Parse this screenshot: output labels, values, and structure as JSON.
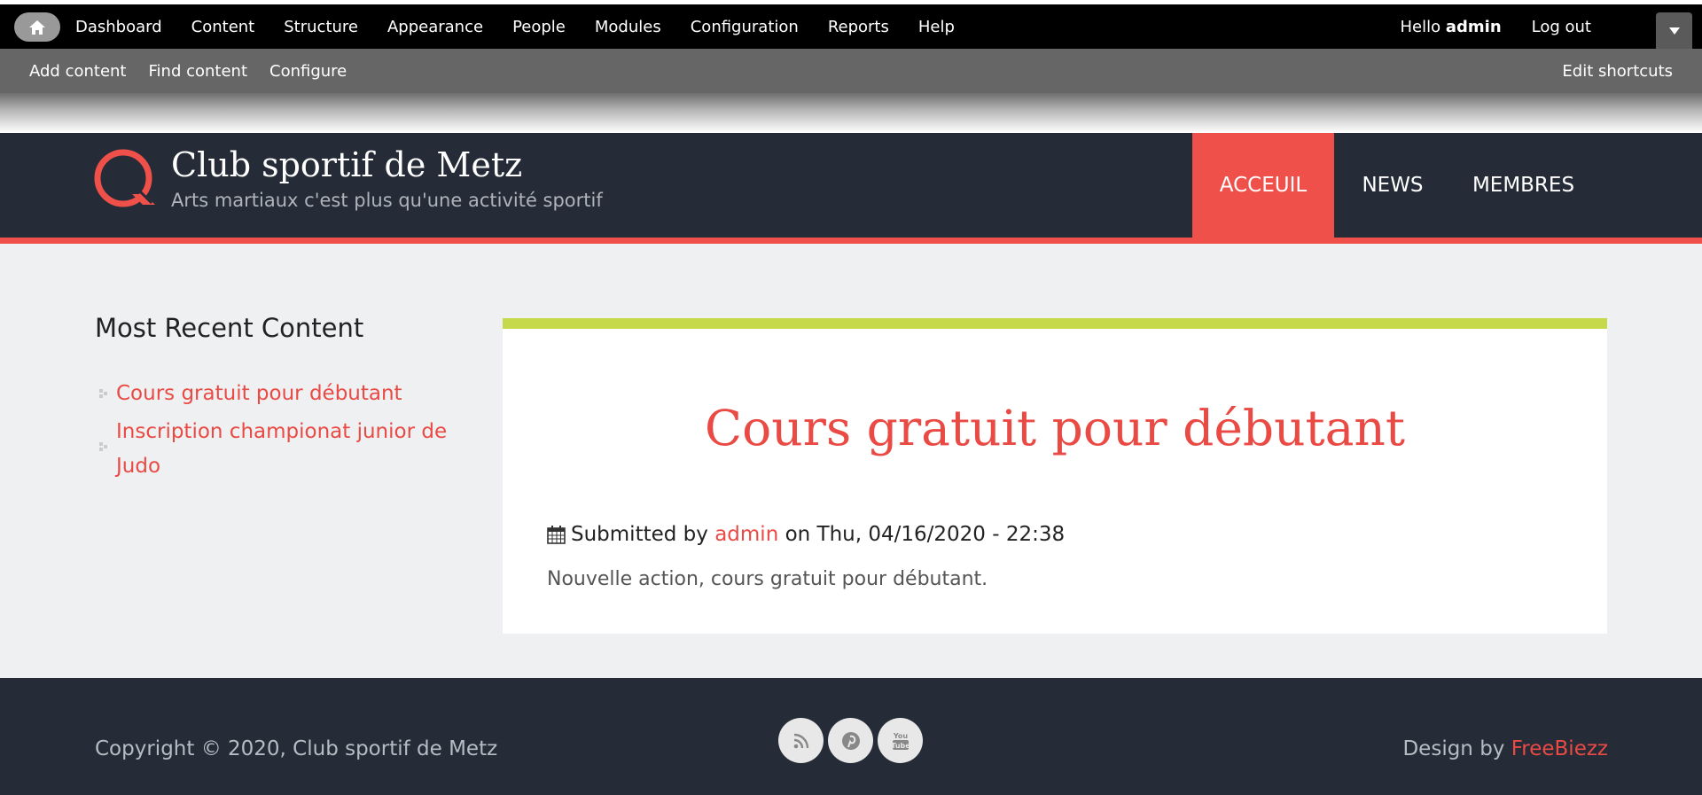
{
  "admin_toolbar": {
    "home_icon": "home-icon",
    "menu": [
      "Dashboard",
      "Content",
      "Structure",
      "Appearance",
      "People",
      "Modules",
      "Configuration",
      "Reports",
      "Help"
    ],
    "hello_prefix": "Hello",
    "username": "admin",
    "logout": "Log out",
    "dropdown_icon": "triangle-down-icon"
  },
  "shortcuts": {
    "items": [
      "Add content",
      "Find content",
      "Configure"
    ],
    "edit": "Edit shortcuts"
  },
  "site": {
    "name": "Club sportif de Metz",
    "slogan": "Arts martiaux c'est plus qu'une activité sportif",
    "nav": [
      "ACCEUIL",
      "NEWS",
      "MEMBRES"
    ],
    "active_nav": "ACCEUIL",
    "accent_color": "#f0504a",
    "header_color": "#252c37"
  },
  "sidebar": {
    "title": "Most Recent Content",
    "items": [
      "Cours gratuit pour débutant",
      "Inscription championat junior de Judo"
    ]
  },
  "article": {
    "title": "Cours gratuit pour débutant",
    "submitted_prefix": "Submitted by",
    "author": "admin",
    "date": "on Thu, 04/16/2020 - 22:38",
    "body": "Nouvelle action, cours gratuit pour débutant.",
    "border_color": "#c5d94b"
  },
  "footer": {
    "copyright": "Copyright © 2020, Club sportif de Metz",
    "socials": [
      "rss-icon",
      "pinterest-icon",
      "youtube-icon"
    ],
    "design_prefix": "Design by",
    "design_link": "FreeBiezz"
  }
}
